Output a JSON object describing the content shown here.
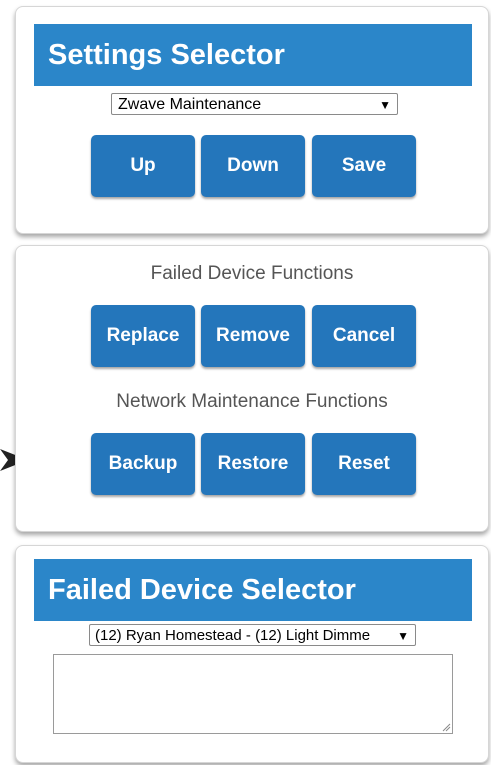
{
  "settings_panel": {
    "title": "Settings Selector",
    "mode_select": {
      "selected": "Zwave Maintenance"
    },
    "buttons": {
      "up": "Up",
      "down": "Down",
      "save": "Save"
    }
  },
  "functions_panel": {
    "failed_label": "Failed Device Functions",
    "failed_buttons": {
      "replace": "Replace",
      "remove": "Remove",
      "cancel": "Cancel"
    },
    "network_label": "Network Maintenance Functions",
    "network_buttons": {
      "backup": "Backup",
      "restore": "Restore",
      "reset": "Reset"
    }
  },
  "failed_device_panel": {
    "title": "Failed Device Selector",
    "device_select": {
      "selected": "(12) Ryan Homestead - (12) Light Dimme"
    },
    "textarea": {
      "value": ""
    }
  },
  "icons": {
    "dropdown": "caret-down-icon",
    "pointer": "arrow-right-icon",
    "resize": "resize-grip-icon"
  },
  "colors": {
    "header_bg": "#2b86c9",
    "button_bg": "#2476bb",
    "label_text": "#555555"
  }
}
